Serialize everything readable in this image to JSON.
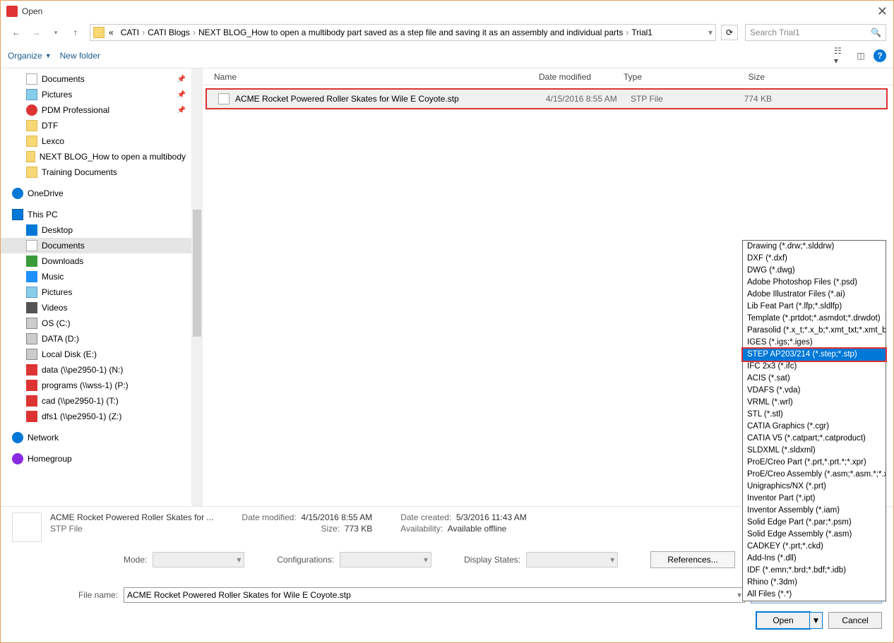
{
  "title": "Open",
  "breadcrumbs": [
    "CATI",
    "CATI Blogs",
    "NEXT BLOG_How to open a multibody part saved as a step file and saving it as an assembly and individual parts",
    "Trial1"
  ],
  "search_placeholder": "Search Trial1",
  "toolbar": {
    "organize": "Organize",
    "new_folder": "New folder"
  },
  "tree": {
    "l1": [
      {
        "icon": "doc",
        "label": "Documents",
        "pin": true
      },
      {
        "icon": "pic",
        "label": "Pictures",
        "pin": true
      },
      {
        "icon": "pdm",
        "label": "PDM Professional",
        "pin": true
      },
      {
        "icon": "folder",
        "label": "DTF"
      },
      {
        "icon": "folder",
        "label": "Lexco"
      },
      {
        "icon": "folder",
        "label": "NEXT BLOG_How to open a multibody"
      },
      {
        "icon": "folder",
        "label": "Training Documents"
      }
    ],
    "onedrive": "OneDrive",
    "thispc": "This PC",
    "pc_items": [
      {
        "icon": "desktop",
        "label": "Desktop"
      },
      {
        "icon": "doc",
        "label": "Documents",
        "sel": true
      },
      {
        "icon": "down",
        "label": "Downloads"
      },
      {
        "icon": "music",
        "label": "Music"
      },
      {
        "icon": "pic",
        "label": "Pictures"
      },
      {
        "icon": "video",
        "label": "Videos"
      },
      {
        "icon": "drive",
        "label": "OS (C:)"
      },
      {
        "icon": "drive",
        "label": "DATA (D:)"
      },
      {
        "icon": "drive",
        "label": "Local Disk (E:)"
      },
      {
        "icon": "netdrive",
        "label": "data (\\\\pe2950-1) (N:)"
      },
      {
        "icon": "netdrive",
        "label": "programs (\\\\wss-1) (P:)"
      },
      {
        "icon": "netdrive",
        "label": "cad (\\\\pe2950-1) (T:)"
      },
      {
        "icon": "netdrive",
        "label": "dfs1 (\\\\pe2950-1) (Z:)"
      }
    ],
    "network": "Network",
    "homegroup": "Homegroup"
  },
  "columns": {
    "name": "Name",
    "date": "Date modified",
    "type": "Type",
    "size": "Size"
  },
  "file": {
    "name": "ACME Rocket Powered Roller Skates for Wile E Coyote.stp",
    "date": "4/15/2016 8:55 AM",
    "type": "STP File",
    "size": "774 KB"
  },
  "details": {
    "name_trunc": "ACME Rocket Powered Roller Skates for ...",
    "type": "STP File",
    "dm_label": "Date modified:",
    "dm_val": "4/15/2016 8:55 AM",
    "sz_label": "Size:",
    "sz_val": "773 KB",
    "dc_label": "Date created:",
    "dc_val": "5/3/2016 11:43 AM",
    "av_label": "Availability:",
    "av_val": "Available offline"
  },
  "opts": {
    "mode": "Mode:",
    "config": "Configurations:",
    "disp": "Display States:",
    "ref": "References..."
  },
  "filename_label": "File name:",
  "filename_value": "ACME Rocket Powered Roller Skates for Wile E Coyote.stp",
  "filter_selected": "All Files (*.*)",
  "open_btn": "Open",
  "cancel_btn": "Cancel",
  "filters": [
    "Drawing (*.drw;*.slddrw)",
    "DXF (*.dxf)",
    "DWG (*.dwg)",
    "Adobe Photoshop Files (*.psd)",
    "Adobe Illustrator Files (*.ai)",
    "Lib Feat Part (*.lfp;*.sldlfp)",
    "Template (*.prtdot;*.asmdot;*.drwdot)",
    "Parasolid (*.x_t;*.x_b;*.xmt_txt;*.xmt_bin",
    "IGES (*.igs;*.iges)",
    "STEP AP203/214 (*.step;*.stp)",
    "IFC 2x3 (*.ifc)",
    "ACIS (*.sat)",
    "VDAFS (*.vda)",
    "VRML (*.wrl)",
    "STL (*.stl)",
    "CATIA Graphics (*.cgr)",
    "CATIA V5 (*.catpart;*.catproduct)",
    "SLDXML (*.sldxml)",
    "ProE/Creo Part (*.prt,*.prt.*;*.xpr)",
    "ProE/Creo Assembly (*.asm;*.asm.*;*.x",
    "Unigraphics/NX (*.prt)",
    "Inventor Part (*.ipt)",
    "Inventor Assembly (*.iam)",
    "Solid Edge Part (*.par;*.psm)",
    "Solid Edge Assembly (*.asm)",
    "CADKEY (*.prt;*.ckd)",
    "Add-Ins (*.dll)",
    "IDF (*.emn;*.brd;*.bdf;*.idb)",
    "Rhino (*.3dm)",
    "All Files (*.*)"
  ],
  "filter_highlight_index": 9
}
